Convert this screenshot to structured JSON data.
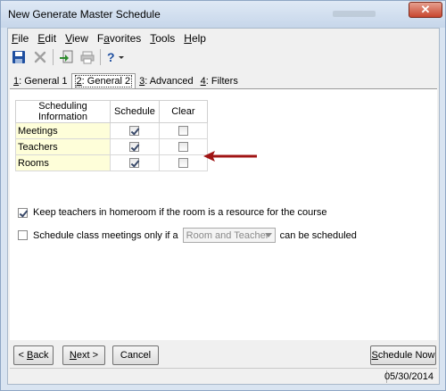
{
  "window": {
    "title": "New Generate Master Schedule",
    "close_glyph": "✕"
  },
  "menu": [
    {
      "label": "File",
      "hotkey": "F",
      "rest": "ile"
    },
    {
      "label": "Edit",
      "hotkey": "E",
      "rest": "dit"
    },
    {
      "label": "View",
      "hotkey": "V",
      "rest": "iew"
    },
    {
      "label": "Favorites",
      "pre": "F",
      "hotkey": "a",
      "rest": "vorites"
    },
    {
      "label": "Tools",
      "hotkey": "T",
      "rest": "ools"
    },
    {
      "label": "Help",
      "hotkey": "H",
      "rest": "elp"
    }
  ],
  "toolbar": {
    "icons": [
      "save-icon",
      "delete-icon",
      "export-icon",
      "print-icon",
      "help-icon"
    ]
  },
  "tabs": [
    {
      "num": "1",
      "label": ": General 1",
      "active": false
    },
    {
      "num": "2",
      "label": ": General 2",
      "active": true
    },
    {
      "num": "3",
      "label": ": Advanced",
      "active": false
    },
    {
      "num": "4",
      "label": ": Filters",
      "active": false
    }
  ],
  "grid": {
    "headers": [
      "Scheduling Information",
      "Schedule",
      "Clear"
    ],
    "rows": [
      {
        "label": "Meetings",
        "schedule": true,
        "clear": false
      },
      {
        "label": "Teachers",
        "schedule": true,
        "clear": false
      },
      {
        "label": "Rooms",
        "schedule": true,
        "clear": false
      }
    ]
  },
  "options": {
    "keep_teachers": {
      "label": "Keep teachers in homeroom if the room is a resource for the course",
      "checked": true
    },
    "schedule_only": {
      "prefix": "Schedule class meetings only if a",
      "select_value": "Room and Teacher",
      "suffix": "can be scheduled",
      "checked": false
    }
  },
  "buttons": {
    "back": {
      "hotkey": "B",
      "rest": "ack",
      "arrow": "<"
    },
    "next": {
      "hotkey": "N",
      "rest": "ext",
      "arrow": ">"
    },
    "cancel": "Cancel",
    "schedule_now": {
      "hotkey": "S",
      "rest": "chedule Now"
    }
  },
  "status": {
    "date": "05/30/2014"
  },
  "colors": {
    "arrow": "#a01414",
    "row_label_bg": "#fefed9"
  }
}
